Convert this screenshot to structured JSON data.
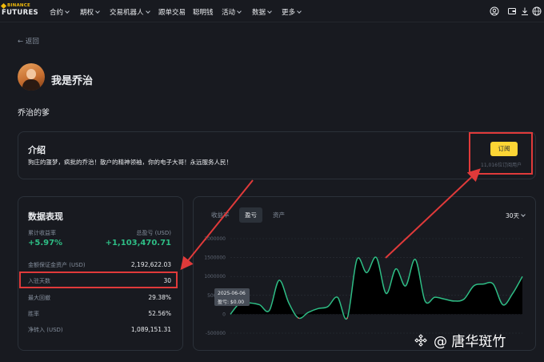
{
  "nav": {
    "logo_top": "BINANCE",
    "logo_bottom": "FUTURES",
    "items": [
      {
        "label": "合约",
        "caret": true
      },
      {
        "label": "期权",
        "caret": true
      },
      {
        "label": "交易机器人",
        "caret": true
      },
      {
        "label": "跟单交易",
        "caret": false
      },
      {
        "label": "聪明钱",
        "caret": false
      },
      {
        "label": "活动",
        "caret": true
      },
      {
        "label": "数据",
        "caret": true
      },
      {
        "label": "更多",
        "caret": true
      }
    ],
    "icons": [
      "user-icon",
      "wallet-icon",
      "download-icon",
      "globe-icon"
    ]
  },
  "back_label": "← 返回",
  "profile": {
    "name": "我是乔治",
    "tagline": "乔治的爹"
  },
  "intro": {
    "title": "介绍",
    "description": "狗庄的噩梦，疯批的乔治！散户的精神领袖，你的电子大哥！永远服务人民！",
    "subscribe_label": "订阅",
    "subscriber_count": "11,016位订阅用户"
  },
  "stats": {
    "title": "数据表现",
    "cumulative_return_label": "累计收益率",
    "total_pnl_label": "总盈亏 (USD)",
    "cumulative_return": "+5.97%",
    "total_pnl": "+1,103,470.71",
    "rows": [
      {
        "label": "金额保证金资产 (USD)",
        "value": "2,192,622.03"
      },
      {
        "label": "入驻天数",
        "value": "30"
      },
      {
        "label": "最大回撤",
        "value": "29.38%"
      },
      {
        "label": "胜率",
        "value": "52.56%"
      },
      {
        "label": "净转入 (USD)",
        "value": "1,089,151.31"
      }
    ]
  },
  "chart": {
    "tabs": [
      "收益率",
      "盈亏",
      "资产"
    ],
    "active_tab": "盈亏",
    "range": "30天",
    "tooltip_date": "2025-06-06",
    "tooltip_value": "盈亏: $0.00",
    "accent": "#2ebd85"
  },
  "chart_data": {
    "type": "area",
    "x": [
      1,
      2,
      3,
      4,
      5,
      6,
      7,
      8,
      9,
      10,
      11,
      12,
      13,
      14,
      15,
      16,
      17,
      18,
      19,
      20,
      21,
      22,
      23,
      24,
      25,
      26,
      27,
      28,
      29,
      30,
      31
    ],
    "values": [
      0,
      300000,
      300000,
      250000,
      100000,
      900000,
      300000,
      -100000,
      50000,
      150000,
      200000,
      450000,
      -100000,
      1450000,
      1100000,
      1500000,
      550000,
      1200000,
      750000,
      1450000,
      350000,
      450000,
      400000,
      350000,
      400000,
      750000,
      800000,
      800000,
      250000,
      550000,
      1000000
    ],
    "yticks": [
      "2000000",
      "1500000",
      "1000000",
      "500000",
      "0",
      "-500000"
    ],
    "ylim": [
      -500000,
      2000000
    ],
    "grid": true,
    "series": [
      {
        "name": "盈亏",
        "color": "#2ebd85"
      }
    ]
  },
  "watermark": "@ 唐华斑竹"
}
